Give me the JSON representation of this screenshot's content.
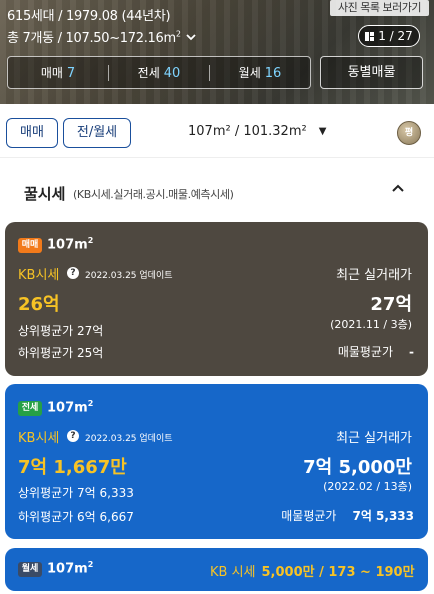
{
  "hero": {
    "info_line1": "615세대 / 1979.08 (44년차)",
    "info_line2": "총 7개동 / 107.50~172.16m",
    "info_line2_sup": "2",
    "photo_list_label": "사진 목록 보러가기",
    "photo_counter": "1 / 27",
    "deal_counts": [
      {
        "label": "매매",
        "count": "7"
      },
      {
        "label": "전세",
        "count": "40"
      },
      {
        "label": "월세",
        "count": "16"
      }
    ],
    "building_button": "동별매물"
  },
  "filter": {
    "sale_chip": "매매",
    "rent_chip": "전/월세",
    "area_label": "107m² / 101.32m²",
    "py_label": "평"
  },
  "section": {
    "title": "꿀시세",
    "subtitle": "(KB시세.실거래.공시.매물.예측시세)"
  },
  "sale_card": {
    "badge": "매매",
    "area": "107m",
    "area_sup": "2",
    "kb_label": "KB시세",
    "update": "2022.03.25 업데이트",
    "kb_price": "26억",
    "upper_avg_label": "상위평균가",
    "upper_avg_value": "27억",
    "lower_avg_label": "하위평균가",
    "lower_avg_value": "25억",
    "recent_label": "최근 실거래가",
    "recent_price": "27억",
    "recent_date": "(2021.11 / 3층)",
    "listing_avg_label": "매물평균가",
    "listing_avg_value": "-"
  },
  "jeonse_card": {
    "badge": "전세",
    "area": "107m",
    "area_sup": "2",
    "kb_label": "KB시세",
    "update": "2022.03.25 업데이트",
    "kb_price": "7억 1,667만",
    "upper_avg_label": "상위평균가",
    "upper_avg_value": "7억 6,333",
    "lower_avg_label": "하위평균가",
    "lower_avg_value": "6억 6,667",
    "recent_label": "최근 실거래가",
    "recent_price": "7억 5,000만",
    "recent_date": "(2022.02 / 13층)",
    "listing_avg_label": "매물평균가",
    "listing_avg_value": "7억 5,333"
  },
  "monthly_card": {
    "badge": "월세",
    "area": "107m",
    "area_sup": "2",
    "kb_label": "KB 시세",
    "kb_value": "5,000만 / 173 ~ 190만"
  },
  "colors": {
    "sale_card_bg": "#4e4840",
    "jeonse_card_bg": "#1667c9",
    "kb_yellow": "#f7c325",
    "sale_badge": "#f27a1a",
    "jeonse_badge": "#26a046"
  }
}
